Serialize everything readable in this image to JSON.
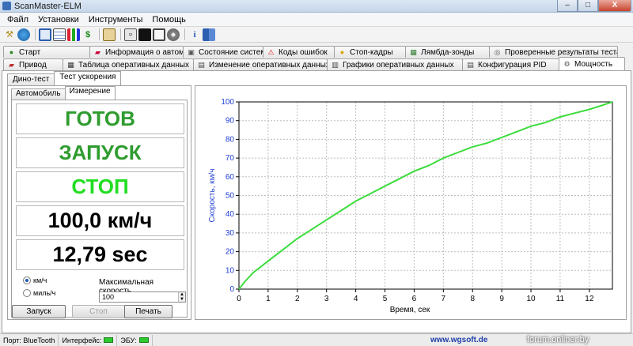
{
  "window": {
    "title": "ScanMaster-ELM",
    "min": "–",
    "max": "□",
    "close": "X"
  },
  "menu": [
    "Файл",
    "Установки",
    "Инструменты",
    "Помощь"
  ],
  "toolbar_icons": [
    "wrench-icon",
    "globe-icon",
    "display-icon",
    "table-icon",
    "bar-chart-icon",
    "dollar-icon",
    "clipboard-icon",
    "connect-icon",
    "terminal-icon",
    "monitor-icon",
    "disc-icon",
    "info-icon",
    "book-icon"
  ],
  "tabs_row1": [
    {
      "label": "Старт",
      "icon": "start-icon"
    },
    {
      "label": "Информация о автомобиле",
      "icon": "car-info-icon"
    },
    {
      "label": "Состояние системы",
      "icon": "system-icon"
    },
    {
      "label": "Коды ошибок",
      "icon": "error-codes-icon"
    },
    {
      "label": "Стоп-кадры",
      "icon": "freeze-frame-icon"
    },
    {
      "label": "Лямбда-зонды",
      "icon": "lambda-icon"
    },
    {
      "label": "Проверенные результаты теста",
      "icon": "test-results-icon"
    }
  ],
  "tabs_row2": [
    {
      "label": "Привод",
      "icon": "drive-icon"
    },
    {
      "label": "Таблица оперативных данных",
      "icon": "live-table-icon"
    },
    {
      "label": "Изменение оперативных данных",
      "icon": "live-edit-icon"
    },
    {
      "label": "Графики оперативных данных",
      "icon": "live-graph-icon"
    },
    {
      "label": "Конфигурация PID",
      "icon": "pid-config-icon"
    },
    {
      "label": "Мощность",
      "icon": "power-icon"
    }
  ],
  "subtabs": [
    "Дино-тест",
    "Тест ускорения"
  ],
  "innertabs": [
    "Автомобиль",
    "Измерение"
  ],
  "status_boxes": {
    "ready": "ГОТОВ",
    "launch": "ЗАПУСК",
    "stop": "СТОП"
  },
  "readouts": {
    "speed": "100,0 км/ч",
    "time": "12,79 sec"
  },
  "units": {
    "kmh": "км/ч",
    "mph": "миль/ч",
    "selected": "kmh"
  },
  "max_speed": {
    "label": "Максимальная скорость",
    "value": "100"
  },
  "buttons": {
    "launch": "Запуск",
    "stop": "Стоп",
    "print": "Печать"
  },
  "chart_data": {
    "type": "line",
    "xlabel": "Время, сек",
    "ylabel": "Скорость, км/ч",
    "xlim": [
      0,
      12.79
    ],
    "ylim": [
      0,
      100
    ],
    "xticks": [
      0,
      1,
      2,
      3,
      4,
      5,
      6,
      7,
      8,
      9,
      10,
      11,
      12
    ],
    "yticks": [
      0,
      10,
      20,
      30,
      40,
      50,
      60,
      70,
      80,
      90,
      100
    ],
    "grid": true,
    "line_color": "#3cdc3c",
    "series": [
      {
        "x": [
          0,
          0.2,
          0.5,
          1,
          1.5,
          2,
          2.5,
          3,
          3.5,
          4,
          4.5,
          5,
          5.5,
          6,
          6.5,
          7,
          7.5,
          8,
          8.5,
          9,
          9.5,
          10,
          10.5,
          11,
          11.5,
          12,
          12.5,
          12.79
        ],
        "values": [
          0,
          4,
          9,
          15,
          21,
          27,
          32,
          37,
          42,
          47,
          51,
          55,
          59,
          63,
          66,
          70,
          73,
          76,
          78,
          81,
          84,
          87,
          89,
          92,
          94,
          96,
          98.5,
          100
        ]
      }
    ]
  },
  "statusbar": {
    "port_label": "Порт: BlueTooth",
    "interface_label": "Интерфейс:",
    "ecu_label": "ЭБУ:",
    "site": "www.wgsoft.de",
    "watermark": "forum.onliner.by"
  }
}
